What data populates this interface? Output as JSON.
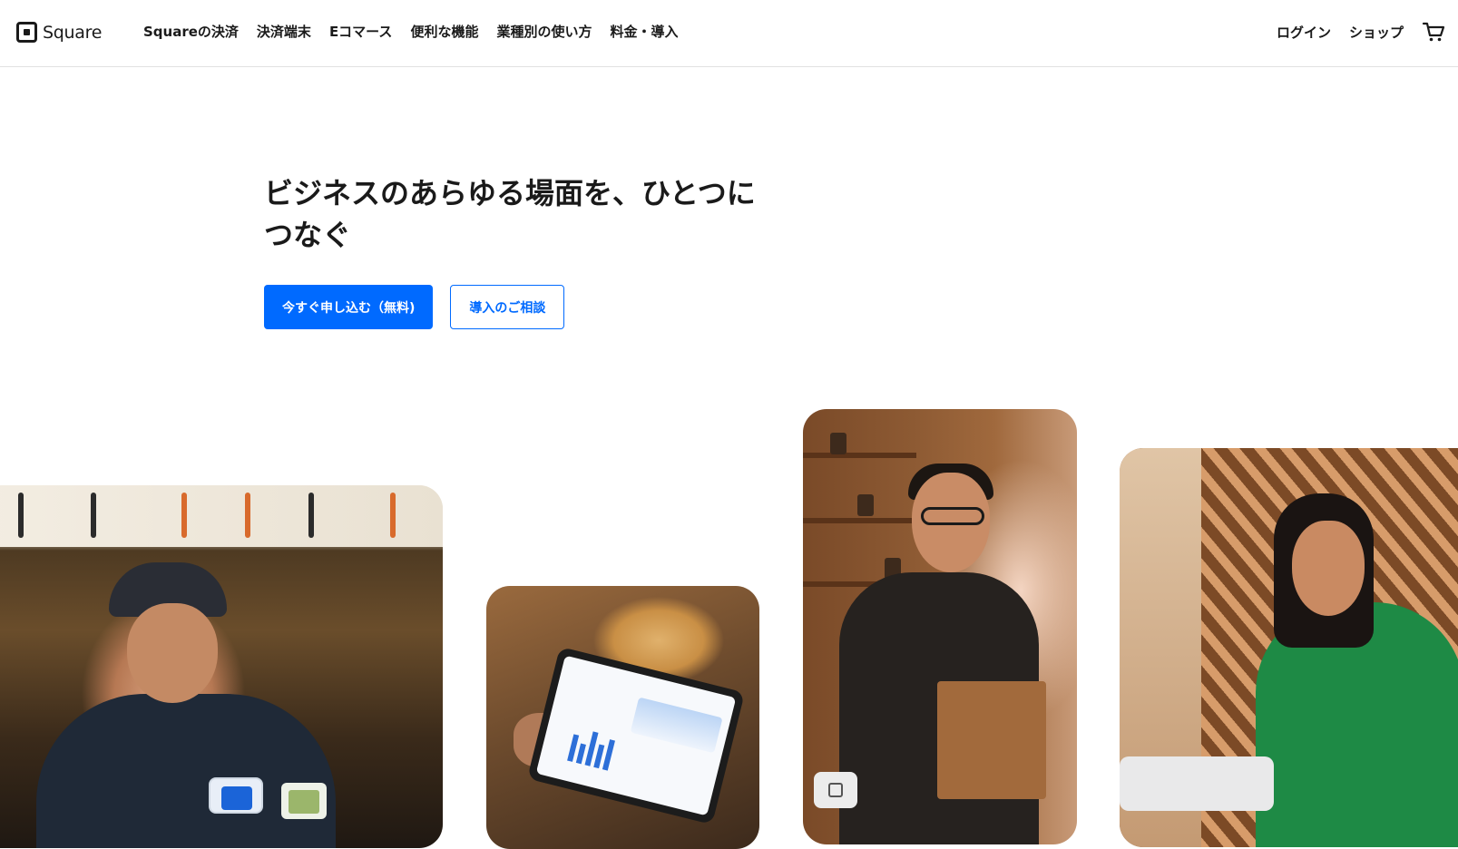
{
  "brand": {
    "name": "Square"
  },
  "nav": {
    "items": [
      {
        "label": "Squareの決済"
      },
      {
        "label": "決済端末"
      },
      {
        "label": "Eコマース"
      },
      {
        "label": "便利な機能"
      },
      {
        "label": "業種別の使い方"
      },
      {
        "label": "料金・導入"
      }
    ],
    "login": "ログイン",
    "shop": "ショップ",
    "cart_icon": "cart-icon"
  },
  "hero": {
    "title_line1": "ビジネスのあらゆる場面を、ひとつに",
    "title_line2": "つなぐ",
    "primary_cta": "今すぐ申し込む（無料)",
    "secondary_cta": "導入のご相談"
  },
  "colors": {
    "accent": "#006aff",
    "text": "#1a1a1a",
    "divider": "#e2e2e2"
  }
}
